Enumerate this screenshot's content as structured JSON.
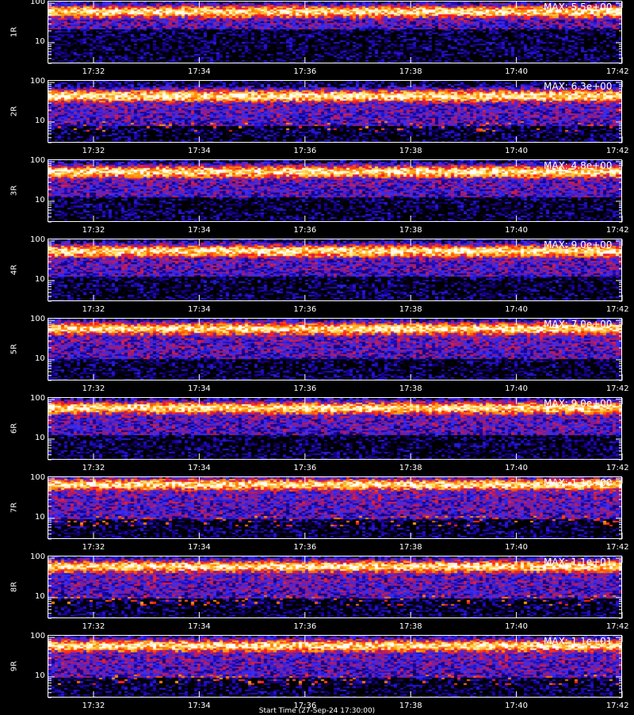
{
  "chart_data": {
    "type": "heatmap",
    "x_ticks": [
      "17:32",
      "17:34",
      "17:36",
      "17:38",
      "17:40",
      "17:42"
    ],
    "y_ticks": [
      "100",
      "10"
    ],
    "y_scale": "log",
    "ylim": [
      3,
      110
    ],
    "panels": [
      {
        "label": "1R",
        "max_label": "MAX: 5.5e+00",
        "band_center": 60,
        "band_low": 22,
        "hot_low": false
      },
      {
        "label": "2R",
        "max_label": "MAX: 6.3e+00",
        "band_center": 45,
        "band_low": 8,
        "hot_low": true
      },
      {
        "label": "3R",
        "max_label": "MAX: 4.8e+00",
        "band_center": 55,
        "band_low": 12,
        "hot_low": false
      },
      {
        "label": "4R",
        "max_label": "MAX: 9.0e+00",
        "band_center": 55,
        "band_low": 12,
        "hot_low": false
      },
      {
        "label": "5R",
        "max_label": "MAX: 7.0e+00",
        "band_center": 60,
        "band_low": 10,
        "hot_low": false
      },
      {
        "label": "6R",
        "max_label": "MAX: 9.0e+00",
        "band_center": 60,
        "band_low": 12,
        "hot_low": false
      },
      {
        "label": "7R",
        "max_label": "MAX: 1.1e+00",
        "band_center": 70,
        "band_low": 9,
        "hot_low": true
      },
      {
        "label": "8R",
        "max_label": "MAX: 1.1e+01",
        "band_center": 60,
        "band_low": 9,
        "hot_low": true
      },
      {
        "label": "9R",
        "max_label": "MAX: 1.1e+01",
        "band_center": 60,
        "band_low": 9,
        "hot_low": true
      }
    ],
    "colormap": [
      "#000000",
      "#1a00a0",
      "#3030ff",
      "#8a1a8a",
      "#ff2020",
      "#ff8a00",
      "#ffe060",
      "#ffffff"
    ]
  },
  "footer": "Start Time (27-Sep-24 17:30:00)"
}
